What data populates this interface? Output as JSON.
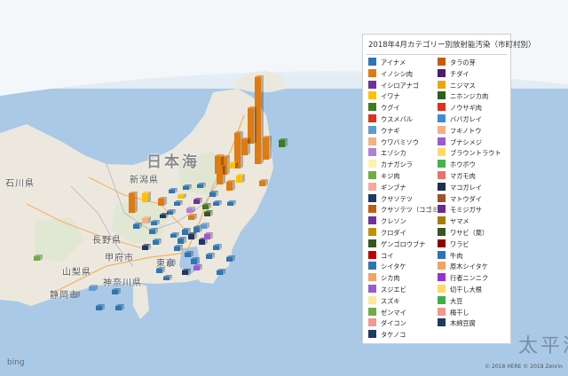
{
  "legend": {
    "title": "2018年4月カテゴリー別放射能汚染（市町村別）",
    "items": [
      {
        "label": "アイナメ",
        "color": "#2e75b6"
      },
      {
        "label": "イノシシ肉",
        "color": "#e07b10"
      },
      {
        "label": "イシロアナゴ",
        "color": "#7030a0"
      },
      {
        "label": "イワナ",
        "color": "#ffc000"
      },
      {
        "label": "ウグイ",
        "color": "#3a7d22"
      },
      {
        "label": "ウスメバル",
        "color": "#e03020"
      },
      {
        "label": "ウナギ",
        "color": "#5b9bd5"
      },
      {
        "label": "ウワバミソウ",
        "color": "#f4b183"
      },
      {
        "label": "エゾシカ",
        "color": "#b27fd6"
      },
      {
        "label": "カナガシラ",
        "color": "#fff2b0"
      },
      {
        "label": "キジ肉",
        "color": "#70ad47"
      },
      {
        "label": "ギンブナ",
        "color": "#f8a8a0"
      },
      {
        "label": "クサソテツ",
        "color": "#1f3864"
      },
      {
        "label": "クサソテツ（コゴミ）",
        "color": "#c55a11"
      },
      {
        "label": "クレソン",
        "color": "#7030a0"
      },
      {
        "label": "クロダイ",
        "color": "#bf9000"
      },
      {
        "label": "ゲンゴロウブナ",
        "color": "#375623"
      },
      {
        "label": "コイ",
        "color": "#c00000"
      },
      {
        "label": "シイタケ",
        "color": "#2e75b6"
      },
      {
        "label": "シカ肉",
        "color": "#f4a460"
      },
      {
        "label": "スジエビ",
        "color": "#9b59d0"
      },
      {
        "label": "スズキ",
        "color": "#ffe699"
      },
      {
        "label": "ゼンマイ",
        "color": "#70ad47"
      },
      {
        "label": "ダイコン",
        "color": "#f4978e"
      },
      {
        "label": "タケノコ",
        "color": "#1f3864"
      },
      {
        "label": "タラの芽",
        "color": "#c55a11"
      },
      {
        "label": "チダイ",
        "color": "#4b1d70"
      },
      {
        "label": "ニジマス",
        "color": "#e8a80c"
      },
      {
        "label": "ニホンジカ肉",
        "color": "#2f5f1e"
      },
      {
        "label": "ノウサギ肉",
        "color": "#e03020"
      },
      {
        "label": "ババガレイ",
        "color": "#3c8dd8"
      },
      {
        "label": "フキノトウ",
        "color": "#f4b183"
      },
      {
        "label": "ブナシメジ",
        "color": "#9b59d0"
      },
      {
        "label": "ブラウントラウト",
        "color": "#ffd966"
      },
      {
        "label": "ホウボウ",
        "color": "#4caf50"
      },
      {
        "label": "マガモ肉",
        "color": "#e8736c"
      },
      {
        "label": "マコガレイ",
        "color": "#1f2d50"
      },
      {
        "label": "マトウダイ",
        "color": "#a0522d"
      },
      {
        "label": "モミジガサ",
        "color": "#6a2c91"
      },
      {
        "label": "ヤマメ",
        "color": "#a67c00"
      },
      {
        "label": "ワサビ（葉）",
        "color": "#375623"
      },
      {
        "label": "ワラビ",
        "color": "#8b0000"
      },
      {
        "label": "牛肉",
        "color": "#2e75b6"
      },
      {
        "label": "原木シイタケ",
        "color": "#f4a460"
      },
      {
        "label": "行者ニンニク",
        "color": "#9b30d0"
      },
      {
        "label": "切干し大根",
        "color": "#ffd966"
      },
      {
        "label": "大豆",
        "color": "#3fae49"
      },
      {
        "label": "梅干し",
        "color": "#f4978e"
      },
      {
        "label": "木綿豆腐",
        "color": "#1f3864"
      }
    ]
  },
  "map": {
    "places": [
      {
        "text": "日本海",
        "class": "big"
      },
      {
        "text": "新潟県",
        "class": ""
      },
      {
        "text": "石川県",
        "class": ""
      },
      {
        "text": "長野県",
        "class": ""
      },
      {
        "text": "甲府市",
        "class": ""
      },
      {
        "text": "山梨県",
        "class": ""
      },
      {
        "text": "静岡市",
        "class": ""
      },
      {
        "text": "東京",
        "class": ""
      },
      {
        "text": "神奈川県",
        "class": ""
      },
      {
        "text": "太平洋",
        "class": "sea"
      }
    ]
  },
  "bing_logo": "bing",
  "copyright": "© 2018 HERE  © 2018 Zenrin"
}
